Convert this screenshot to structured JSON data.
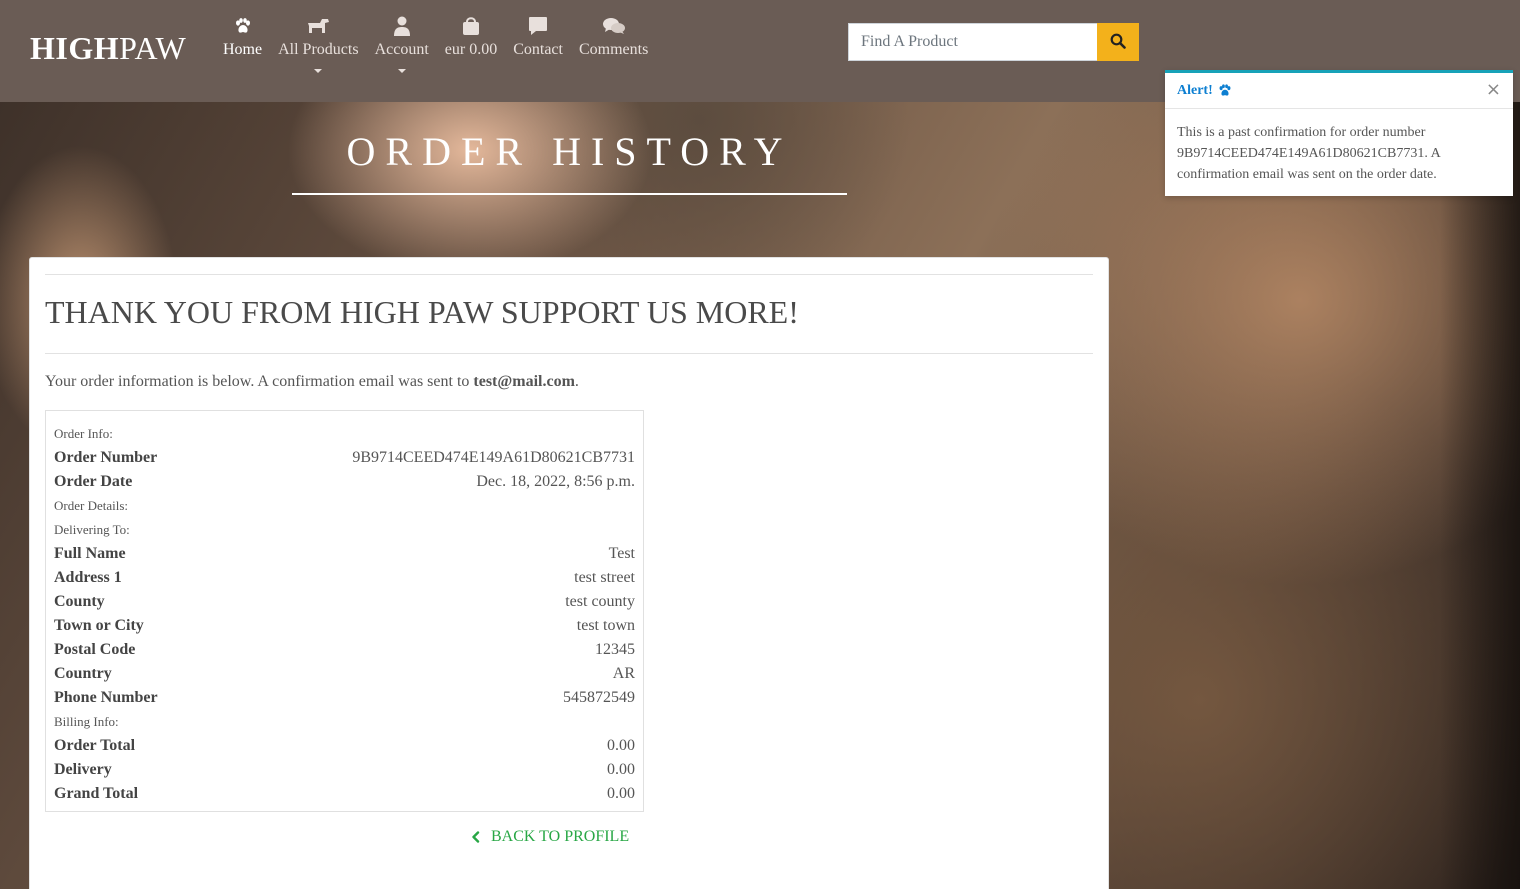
{
  "brand": {
    "bold": "HIGH",
    "normal": "PAW"
  },
  "nav": {
    "home": "Home",
    "all_products": "All Products",
    "account": "Account",
    "bag": "eur 0.00",
    "contact": "Contact",
    "comments": "Comments"
  },
  "search": {
    "placeholder": "Find A Product"
  },
  "page_title": "ORDER HISTORY",
  "card": {
    "thanks": "THANK YOU FROM HIGH PAW SUPPORT US MORE!",
    "info_prefix": "Your order information is below. A confirmation email was sent to ",
    "email": "test@mail.com",
    "info_suffix": ".",
    "back": "BACK TO PROFILE"
  },
  "order": {
    "order_info_label": "Order Info:",
    "order_number_label": "Order Number",
    "order_number": "9B9714CEED474E149A61D80621CB7731",
    "order_date_label": "Order Date",
    "order_date": "Dec. 18, 2022, 8:56 p.m.",
    "order_details_label": "Order Details:",
    "delivering_label": "Delivering To:",
    "full_name_label": "Full Name",
    "full_name": "Test",
    "address1_label": "Address 1",
    "address1": "test street",
    "county_label": "County",
    "county": "test county",
    "town_label": "Town or City",
    "town": "test town",
    "postal_label": "Postal Code",
    "postal": "12345",
    "country_label": "Country",
    "country": "AR",
    "phone_label": "Phone Number",
    "phone": "545872549",
    "billing_label": "Billing Info:",
    "order_total_label": "Order Total",
    "order_total": "0.00",
    "delivery_label": "Delivery",
    "delivery": "0.00",
    "grand_total_label": "Grand Total",
    "grand_total": "0.00"
  },
  "toast": {
    "title": "Alert!",
    "close": "×",
    "message": "This is a past confirmation for order number 9B9714CEED474E149A61D80621CB7731. A confirmation email was sent on the order date."
  },
  "colors": {
    "header": "#6a5c55",
    "search_button": "#f3b11b",
    "link_green": "#28a745",
    "toast_accent": "#17a2b8",
    "toast_title": "#0d7fd1"
  },
  "icons": {
    "home": "paw-icon",
    "all_products": "dog-icon",
    "account": "user-icon",
    "bag": "shopping-bag-icon",
    "contact": "comment-icon",
    "comments": "comments-icon",
    "search": "search-icon",
    "back": "chevron-left-icon"
  }
}
